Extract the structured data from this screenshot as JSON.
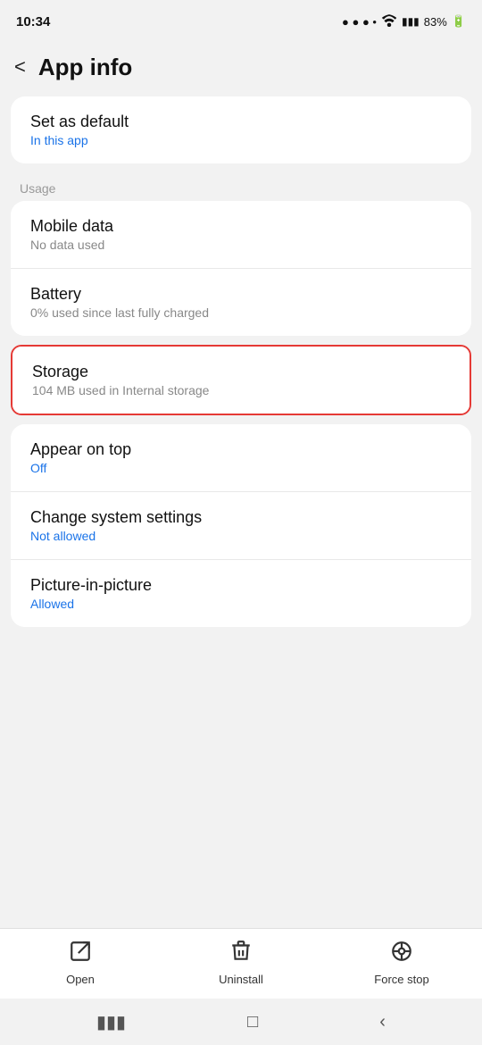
{
  "statusBar": {
    "time": "10:34",
    "battery": "83%",
    "batteryIcon": "battery-icon",
    "wifiIcon": "wifi-icon",
    "signalIcon": "signal-icon"
  },
  "header": {
    "backLabel": "<",
    "title": "App info"
  },
  "setDefault": {
    "title": "Set as default",
    "subtitle": "In this app"
  },
  "sectionLabel": "Usage",
  "usageItems": [
    {
      "title": "Mobile data",
      "subtitle": "No data used"
    },
    {
      "title": "Battery",
      "subtitle": "0% used since last fully charged"
    }
  ],
  "storage": {
    "title": "Storage",
    "subtitle": "104 MB used in Internal storage"
  },
  "permissionItems": [
    {
      "title": "Appear on top",
      "subtitle": "Off",
      "subtitleClass": "off"
    },
    {
      "title": "Change system settings",
      "subtitle": "Not allowed",
      "subtitleClass": "not-allowed"
    },
    {
      "title": "Picture-in-picture",
      "subtitle": "Allowed",
      "subtitleClass": "allowed"
    }
  ],
  "bottomActions": [
    {
      "label": "Open",
      "icon": "open-icon"
    },
    {
      "label": "Uninstall",
      "icon": "uninstall-icon"
    },
    {
      "label": "Force stop",
      "icon": "force-stop-icon"
    }
  ],
  "navBar": {
    "recentIcon": "recent-apps-icon",
    "homeIcon": "home-icon",
    "backIcon": "back-icon"
  }
}
